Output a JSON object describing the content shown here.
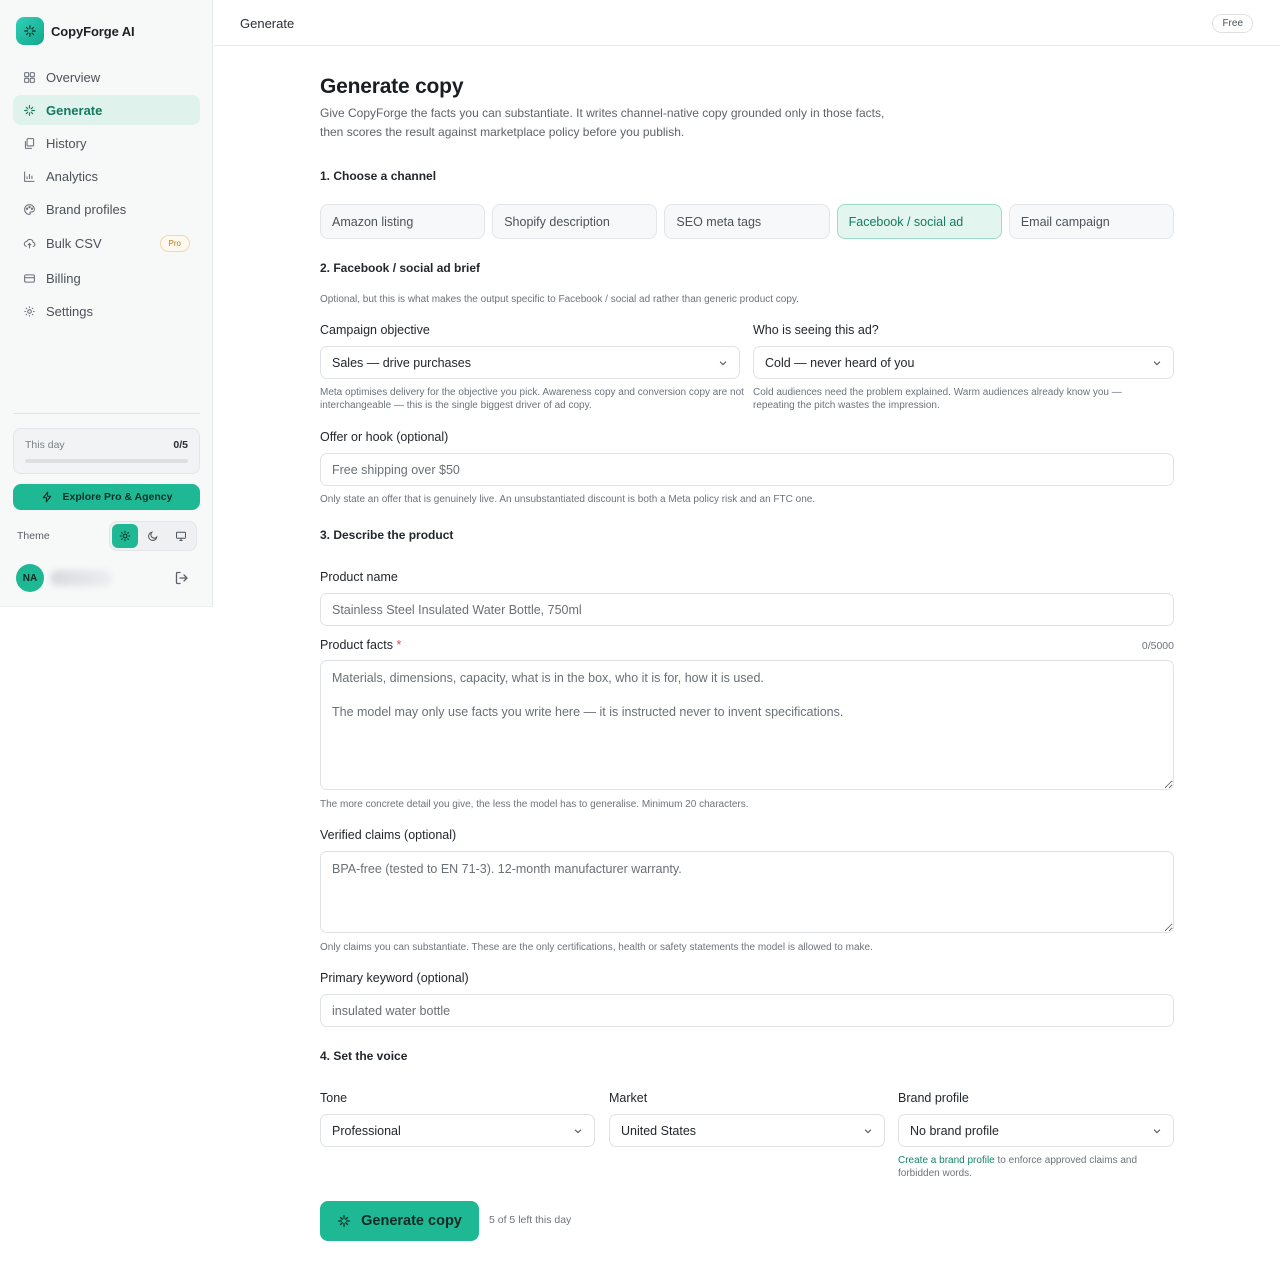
{
  "app": {
    "name": "CopyForge AI"
  },
  "sidebar": {
    "items": [
      {
        "label": "Overview",
        "icon": "grid-icon"
      },
      {
        "label": "Generate",
        "icon": "sparkle-icon"
      },
      {
        "label": "History",
        "icon": "history-icon"
      },
      {
        "label": "Analytics",
        "icon": "bar-chart-icon"
      },
      {
        "label": "Brand profiles",
        "icon": "palette-icon"
      },
      {
        "label": "Bulk CSV",
        "icon": "upload-cloud-icon",
        "tag": "Pro"
      },
      {
        "label": "Billing",
        "icon": "credit-card-icon"
      },
      {
        "label": "Settings",
        "icon": "gear-icon"
      }
    ],
    "usage": {
      "label": "This day",
      "count": "0/5",
      "progress": 0
    },
    "upgrade_label": "Explore Pro & Agency",
    "theme_label": "Theme",
    "user_initials": "NA"
  },
  "topbar": {
    "title": "Generate",
    "plan": "Free"
  },
  "main": {
    "title": "Generate copy",
    "subtitle": "Give CopyForge the facts you can substantiate. It writes channel-native copy grounded only in those facts, then scores the result against marketplace policy before you publish.",
    "step1": {
      "title": "1. Choose a channel",
      "channels": [
        "Amazon listing",
        "Shopify description",
        "SEO meta tags",
        "Facebook / social ad",
        "Email campaign"
      ],
      "selected": "Facebook / social ad"
    },
    "step2": {
      "title": "2. Facebook / social ad brief",
      "hint": "Optional, but this is what makes the output specific to Facebook / social ad rather than generic product copy.",
      "objective": {
        "label": "Campaign objective",
        "value": "Sales — drive purchases",
        "help": "Meta optimises delivery for the objective you pick. Awareness copy and conversion copy are not interchangeable — this is the single biggest driver of ad copy."
      },
      "audience": {
        "label": "Who is seeing this ad?",
        "value": "Cold — never heard of you",
        "help": "Cold audiences need the problem explained. Warm audiences already know you — repeating the pitch wastes the impression."
      },
      "offer": {
        "label": "Offer or hook (optional)",
        "placeholder": "Free shipping over $50",
        "help": "Only state an offer that is genuinely live. An unsubstantiated discount is both a Meta policy risk and an FTC one."
      }
    },
    "step3": {
      "title": "3. Describe the product",
      "product_name": {
        "label": "Product name",
        "placeholder": "Stainless Steel Insulated Water Bottle, 750ml"
      },
      "product_facts": {
        "label": "Product facts",
        "required_mark": "*",
        "counter": "0/5000",
        "placeholder": "Materials, dimensions, capacity, what is in the box, who it is for, how it is used.\n\nThe model may only use facts you write here — it is instructed never to invent specifications.",
        "help": "The more concrete detail you give, the less the model has to generalise. Minimum 20 characters."
      },
      "verified_claims": {
        "label": "Verified claims (optional)",
        "placeholder": "BPA-free (tested to EN 71-3). 12-month manufacturer warranty.",
        "help": "Only claims you can substantiate. These are the only certifications, health or safety statements the model is allowed to make."
      },
      "keyword": {
        "label": "Primary keyword (optional)",
        "placeholder": "insulated water bottle"
      }
    },
    "step4": {
      "title": "4. Set the voice",
      "tone": {
        "label": "Tone",
        "value": "Professional"
      },
      "market": {
        "label": "Market",
        "value": "United States"
      },
      "brand": {
        "label": "Brand profile",
        "value": "No brand profile",
        "help_link": "Create a brand profile",
        "help_rest": " to enforce approved claims and forbidden words."
      }
    },
    "generate_label": "Generate copy",
    "remaining": "5 of 5 left this day"
  },
  "colors": {
    "accent": "#1fb894",
    "accent_soft": "#dff3ec",
    "accent_text": "#14795f",
    "required": "#e5484d"
  }
}
